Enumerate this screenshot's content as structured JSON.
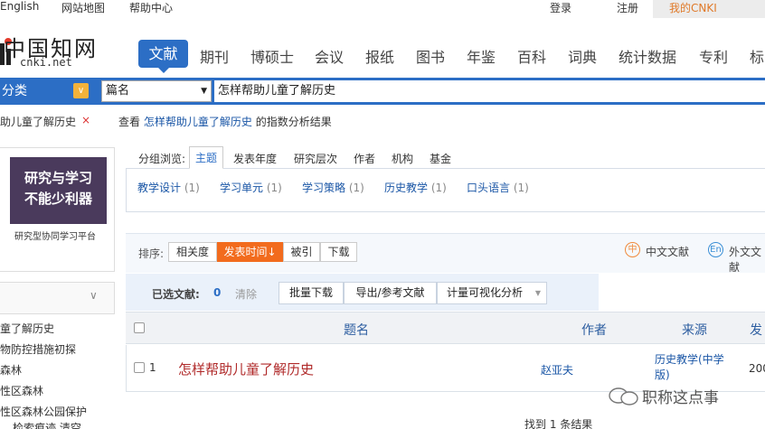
{
  "top_links": {
    "english": "English",
    "sitemap": "网站地图",
    "help": "帮助中心",
    "login": "登录",
    "register": "注册",
    "my_cnki": "我的CNKI"
  },
  "logo": {
    "name_cn": "中国知网",
    "name_en": "cnki.net"
  },
  "nav": {
    "active": "文献",
    "items": [
      "期刊",
      "博硕士",
      "会议",
      "报纸",
      "图书",
      "年鉴",
      "百科",
      "词典",
      "统计数据",
      "专利",
      "标"
    ]
  },
  "search": {
    "category_label": "分类",
    "field": "篇名",
    "query": "怎样帮助儿童了解历史"
  },
  "query_line": {
    "tag": "助儿童了解历史",
    "close": "×",
    "analysis_prefix": "查看",
    "analysis_link": "怎样帮助儿童了解历史",
    "analysis_suffix": "的指数分析结果"
  },
  "promo": {
    "line1": "研究与学习",
    "line2": "不能少利器",
    "caption": "研究型协同学习平台"
  },
  "sidebar_links": [
    "童了解历史",
    "物防控措施初探",
    "森林",
    "性区森林",
    "性区森林公园保护",
    "检索痕迹 清空"
  ],
  "group": {
    "label": "分组浏览:",
    "tabs": [
      "主题",
      "发表年度",
      "研究层次",
      "作者",
      "机构",
      "基金"
    ],
    "subjects": [
      {
        "name": "教学设计",
        "count": "(1)"
      },
      {
        "name": "学习单元",
        "count": "(1)"
      },
      {
        "name": "学习策略",
        "count": "(1)"
      },
      {
        "name": "历史教学",
        "count": "(1)"
      },
      {
        "name": "口头语言",
        "count": "(1)"
      }
    ]
  },
  "sort": {
    "label": "排序:",
    "buttons": [
      "相关度",
      "发表时间",
      "被引",
      "下载"
    ],
    "active": "发表时间",
    "chinese": "中文文献",
    "foreign": "外文文献"
  },
  "selection": {
    "label": "已选文献:",
    "count": "0",
    "clear": "清除",
    "batch_download": "批量下载",
    "export": "导出/参考文献",
    "viz": "计量可视化分析"
  },
  "table": {
    "headers": {
      "title": "题名",
      "author": "作者",
      "source": "来源",
      "date": "发"
    },
    "rows": [
      {
        "num": "1",
        "title": "怎样帮助儿童了解历史",
        "author": "赵亚夫",
        "source": "历史教学(中学版)",
        "date": "200"
      }
    ]
  },
  "found_text": "找到 1 条结果",
  "watermark": "职称这点事",
  "colors": {
    "brand_blue": "#2c6ec5",
    "orange": "#f26b1d",
    "title_red": "#b02a2a"
  }
}
